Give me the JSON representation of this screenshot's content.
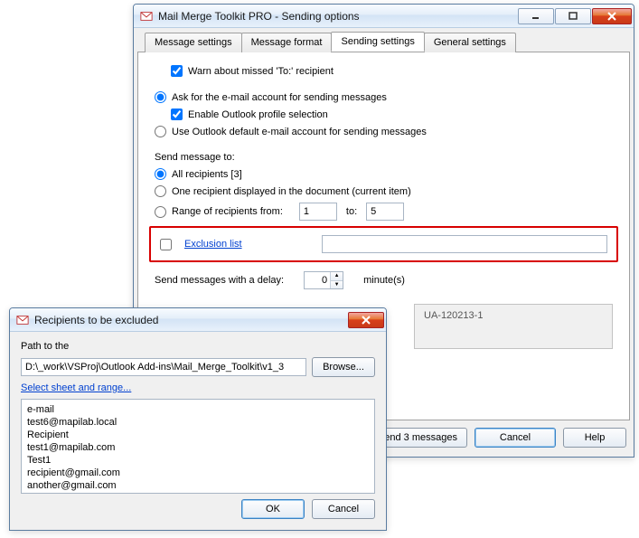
{
  "main": {
    "title": "Mail Merge Toolkit PRO - Sending options",
    "tabs": {
      "message_settings": "Message settings",
      "message_format": "Message format",
      "sending_settings": "Sending settings",
      "general_settings": "General settings"
    },
    "warn_label": "Warn about missed 'To:' recipient",
    "ask_account_label": "Ask for the e-mail account for sending messages",
    "enable_outlook_label": "Enable Outlook profile selection",
    "use_default_label": "Use Outlook default e-mail account for sending messages",
    "send_to_heading": "Send message to:",
    "all_recipients_label": "All recipients [3]",
    "one_recipient_label": "One recipient displayed in the document (current item)",
    "range_from_label": "Range of recipients from:",
    "range_from_value": "1",
    "range_to_label": "to:",
    "range_to_value": "5",
    "exclusion_link": "Exclusion list",
    "exclusion_value": "",
    "delay_label": "Send messages with a delay:",
    "delay_value": "0",
    "delay_unit": "minute(s)",
    "ga_value": "UA-120213-1",
    "send_btn": "Send 3 messages",
    "cancel_btn": "Cancel",
    "help_btn": "Help"
  },
  "dialog": {
    "title": "Recipients to be excluded",
    "path_label": "Path to the",
    "path_value": "D:\\_work\\VSProj\\Outlook Add-ins\\Mail_Merge_Toolkit\\v1_3",
    "browse_btn": "Browse...",
    "select_sheet_link": "Select sheet and range...",
    "list_text": "e-mail\ntest6@mapilab.local\nRecipient\ntest1@mapilab.com\nTest1\nrecipient@gmail.com\nanother@gmail.com",
    "ok_btn": "OK",
    "cancel_btn": "Cancel"
  }
}
